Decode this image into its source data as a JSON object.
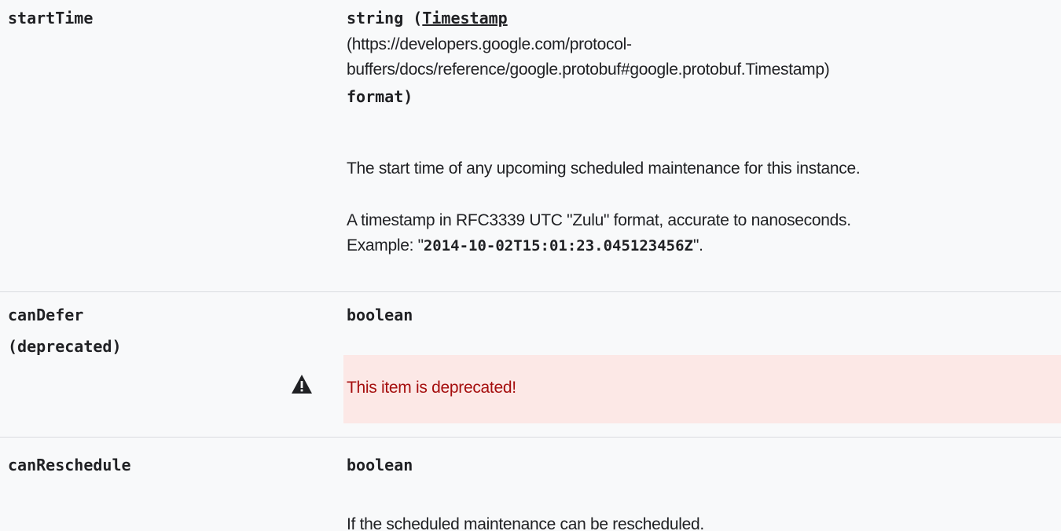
{
  "fields": [
    {
      "name": "startTime",
      "type_prefix": "string (",
      "type_link": "Timestamp",
      "type_url": " (https://developers.google.com/protocol-",
      "type_url_cont": "buffers/docs/reference/google.protobuf#google.protobuf.Timestamp)",
      "type_suffix": "format)",
      "description": "The start time of any upcoming scheduled maintenance for this instance.",
      "timestamp_note_1": "A timestamp in RFC3339 UTC \"Zulu\" format, accurate to nanoseconds.",
      "timestamp_note_2_prefix": "Example: \"",
      "timestamp_example": "2014-10-02T15:01:23.045123456Z",
      "timestamp_note_2_suffix": "\"."
    },
    {
      "name": "canDefer",
      "name_suffix": "(deprecated)",
      "type": "boolean",
      "deprecated_notice": "This item is deprecated!",
      "deprecated_icon": "warning-icon"
    },
    {
      "name": "canReschedule",
      "type": "boolean",
      "description": "If the scheduled maintenance can be rescheduled."
    }
  ],
  "colors": {
    "row_background": "#f8f9fa",
    "separator": "#dadce0",
    "deprecated_background": "#fce8e6",
    "deprecated_text": "#a50e0e",
    "text": "#202124"
  }
}
